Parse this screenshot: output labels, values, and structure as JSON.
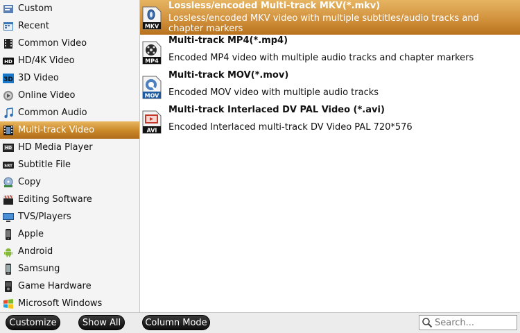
{
  "sidebar": {
    "items": [
      {
        "label": "Custom",
        "icon": "custom-icon"
      },
      {
        "label": "Recent",
        "icon": "recent-icon"
      },
      {
        "label": "Common Video",
        "icon": "film-icon"
      },
      {
        "label": "HD/4K Video",
        "icon": "hd-icon"
      },
      {
        "label": "3D Video",
        "icon": "3d-icon"
      },
      {
        "label": "Online Video",
        "icon": "online-video-icon"
      },
      {
        "label": "Common Audio",
        "icon": "music-note-icon"
      },
      {
        "label": "Multi-track Video",
        "icon": "film-strip-icon"
      },
      {
        "label": "HD Media Player",
        "icon": "hd-player-icon"
      },
      {
        "label": "Subtitle File",
        "icon": "subtitle-icon"
      },
      {
        "label": "Copy",
        "icon": "copy-icon"
      },
      {
        "label": "Editing Software",
        "icon": "clapperboard-icon"
      },
      {
        "label": "TVS/Players",
        "icon": "tv-icon"
      },
      {
        "label": "Apple",
        "icon": "phone-icon"
      },
      {
        "label": "Android",
        "icon": "android-icon"
      },
      {
        "label": "Samsung",
        "icon": "samsung-phone-icon"
      },
      {
        "label": "Game Hardware",
        "icon": "gamepad-icon"
      },
      {
        "label": "Microsoft Windows",
        "icon": "windows-icon"
      }
    ],
    "selected_index": 7
  },
  "formats": [
    {
      "title": "Lossless/encoded Multi-track MKV(*.mkv)",
      "desc": "Lossless/encoded MKV video with multiple subtitles/audio tracks and chapter markers",
      "badge": "MKV"
    },
    {
      "title": "Multi-track MP4(*.mp4)",
      "desc": "Encoded MP4 video with multiple audio tracks and chapter markers",
      "badge": "MP4"
    },
    {
      "title": "Multi-track MOV(*.mov)",
      "desc": "Encoded MOV video with multiple audio tracks",
      "badge": "MOV"
    },
    {
      "title": "Multi-track Interlaced DV PAL Video (*.avi)",
      "desc": "Encoded Interlaced multi-track DV Video PAL 720*576",
      "badge": "AVI"
    }
  ],
  "bottom": {
    "customize_label": "Customize",
    "show_all_label": "Show All",
    "column_mode_label": "Column Mode",
    "search_placeholder": "Search..."
  },
  "colors": {
    "selection": "#c98728",
    "button_bg": "#111111"
  }
}
